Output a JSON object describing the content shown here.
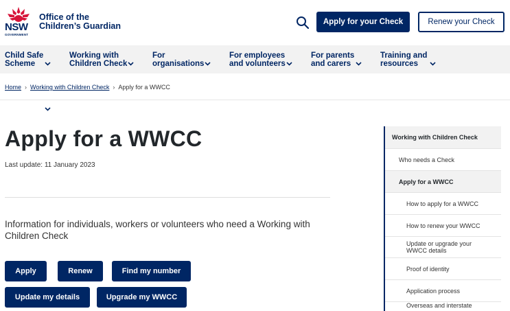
{
  "header": {
    "logo": {
      "wordmark": "NSW",
      "sub": "GOVERNMENT"
    },
    "office_line1": "Office of the",
    "office_line2": "Children’s Guardian",
    "apply_button": "Apply for your Check",
    "renew_button": "Renew your Check"
  },
  "nav": {
    "items": [
      {
        "line1": "Child Safe",
        "line2": "Scheme"
      },
      {
        "line1": "Working with",
        "line2": "Children Check"
      },
      {
        "line1": "For",
        "line2": "organisations"
      },
      {
        "line1": "For employees",
        "line2": "and volunteers"
      },
      {
        "line1": "For parents",
        "line2": "and carers"
      },
      {
        "line1": "Training and",
        "line2": "resources"
      }
    ]
  },
  "breadcrumb": {
    "home": "Home",
    "section": "Working with Children Check",
    "current": "Apply for a WWCC"
  },
  "main": {
    "title": "Apply for a WWCC",
    "last_update": "Last update: 11 January 2023",
    "intro": "Information for individuals, workers or volunteers who need a Working with Children Check",
    "buttons": {
      "apply": "Apply",
      "renew": "Renew",
      "find_number": "Find my number",
      "update_details": "Update my details",
      "upgrade": "Upgrade my WWCC"
    }
  },
  "side_nav": {
    "heading": "Working with Children Check",
    "items": [
      {
        "label": "Who needs a Check"
      },
      {
        "label": "Apply for a WWCC"
      },
      {
        "label": "How to apply for a WWCC"
      },
      {
        "label": "How to renew your WWCC"
      },
      {
        "label_line1": "Update or upgrade your",
        "label_line2": "WWCC details"
      },
      {
        "label": "Proof of identity"
      },
      {
        "label": "Application process"
      },
      {
        "label": "Overseas and interstate"
      }
    ]
  },
  "colors": {
    "brand_navy": "#002664",
    "logo_red": "#d7153a",
    "nav_bg": "#f2f2f2"
  }
}
